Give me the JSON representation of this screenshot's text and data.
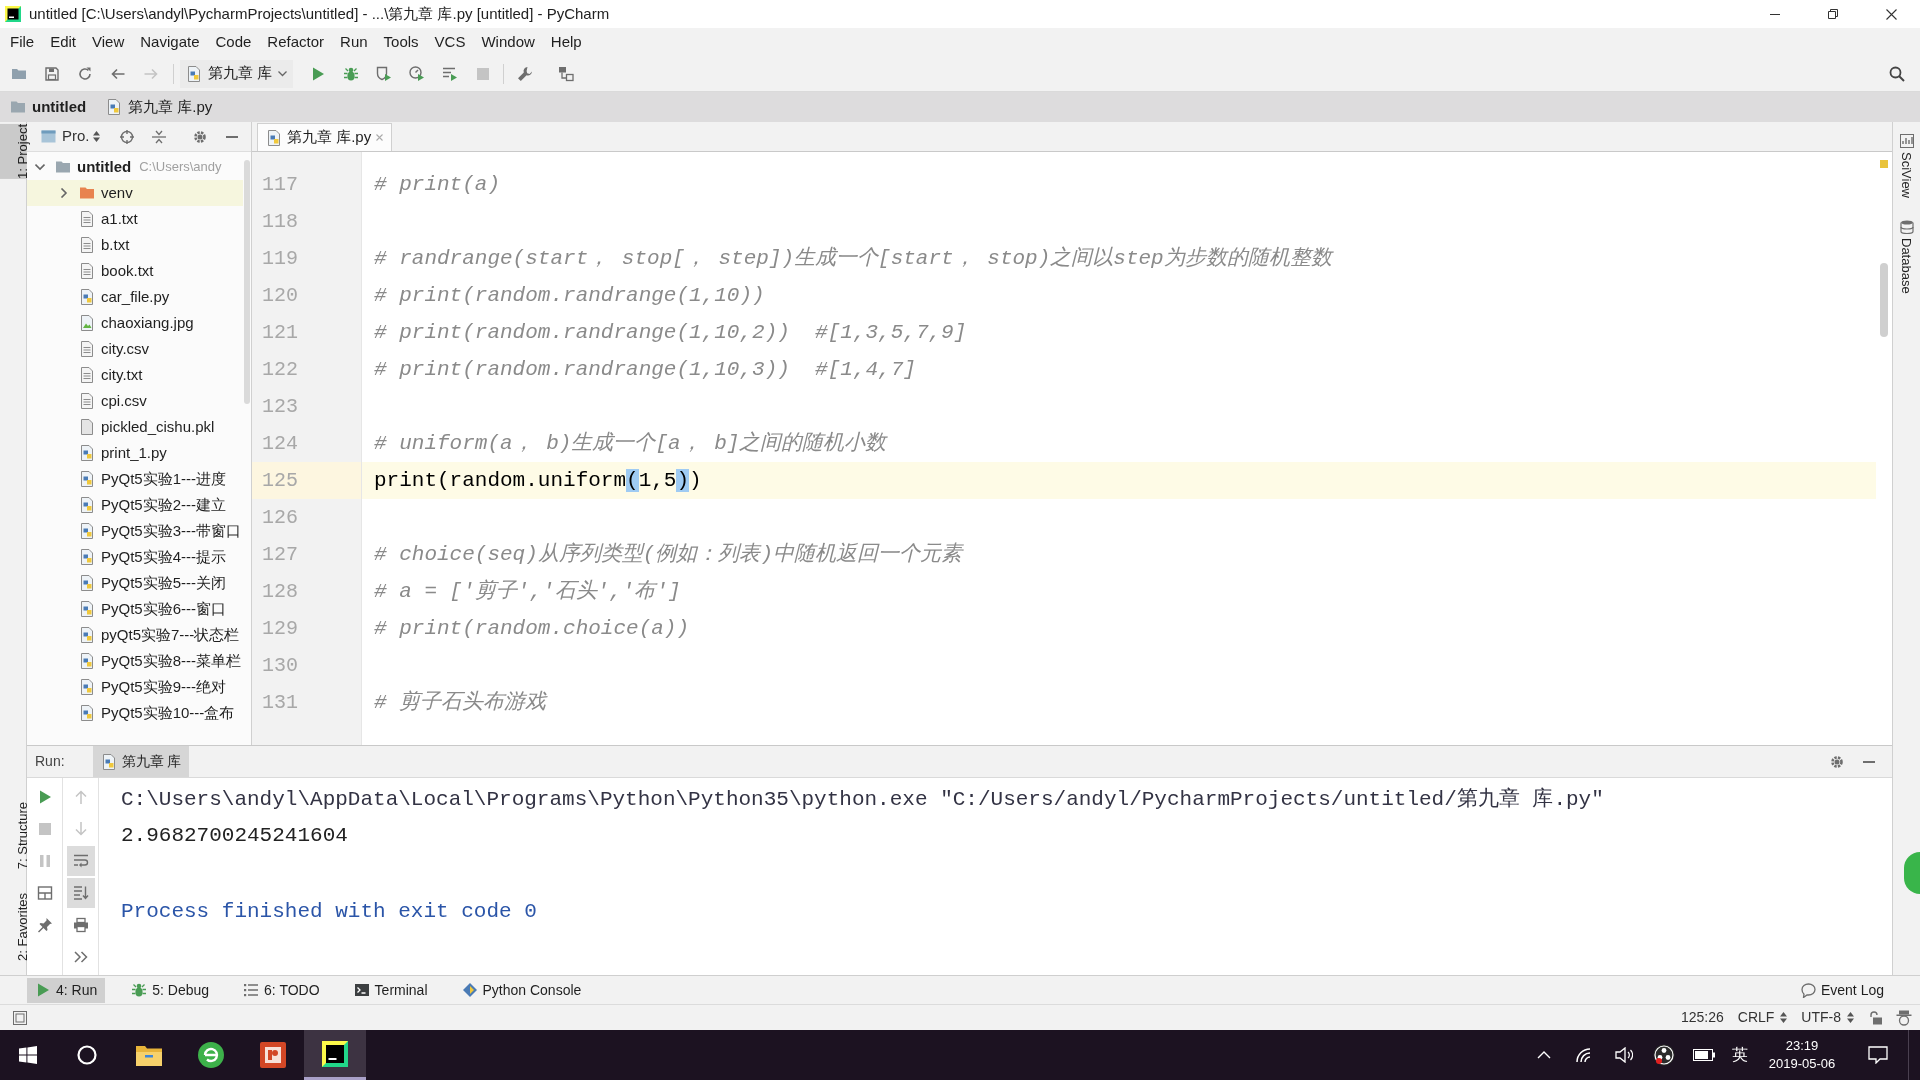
{
  "window": {
    "title": "untitled [C:\\Users\\andyl\\PycharmProjects\\untitled] - ...\\第九章 库.py [untitled] - PyCharm"
  },
  "menu": [
    "File",
    "Edit",
    "View",
    "Navigate",
    "Code",
    "Refactor",
    "Run",
    "Tools",
    "VCS",
    "Window",
    "Help"
  ],
  "toolbar": {
    "buttons": [
      {
        "kind": "open",
        "disabled": false
      },
      {
        "kind": "save",
        "disabled": false
      },
      {
        "kind": "sync",
        "disabled": false
      },
      {
        "kind": "back",
        "disabled": false
      },
      {
        "kind": "forward",
        "disabled": true
      }
    ],
    "run_config": "第九章 库",
    "actions": [
      {
        "kind": "run",
        "disabled": false
      },
      {
        "kind": "debug",
        "disabled": false
      },
      {
        "kind": "coverage",
        "disabled": false
      },
      {
        "kind": "profile",
        "disabled": false
      },
      {
        "kind": "concurrency",
        "disabled": false
      },
      {
        "kind": "stop",
        "disabled": true
      }
    ],
    "tools": [
      {
        "kind": "settings",
        "disabled": false
      },
      {
        "kind": "structure",
        "disabled": false
      }
    ]
  },
  "navigation_bar": [
    {
      "kind": "project",
      "label": "untitled"
    },
    {
      "kind": "python",
      "label": "第九章 库.py"
    }
  ],
  "left_strip": {
    "top": [
      {
        "label": "1: Project",
        "selected": true
      }
    ],
    "bottom": [
      {
        "label": "7: Structure",
        "selected": false
      },
      {
        "label": "2: Favorites",
        "selected": false
      }
    ]
  },
  "right_strip": [
    {
      "kind": "sciview",
      "label": "SciView"
    },
    {
      "kind": "database",
      "label": "Database"
    }
  ],
  "project_panel": {
    "title": "Pro.",
    "tree": [
      {
        "kind": "project",
        "label": "untitled",
        "path": "C:\\Users\\andy",
        "expanded": true,
        "selected": false,
        "children": [
          {
            "kind": "excluded_folder",
            "label": "venv",
            "expanded": false,
            "selected": true
          },
          {
            "kind": "text",
            "label": "a1.txt",
            "selected": false
          },
          {
            "kind": "text",
            "label": "b.txt",
            "selected": false
          },
          {
            "kind": "text",
            "label": "book.txt",
            "selected": false
          },
          {
            "kind": "python",
            "label": "car_file.py",
            "selected": false
          },
          {
            "kind": "image",
            "label": "chaoxiang.jpg",
            "selected": false
          },
          {
            "kind": "text",
            "label": "city.csv",
            "selected": false
          },
          {
            "kind": "text",
            "label": "city.txt",
            "selected": false
          },
          {
            "kind": "text",
            "label": "cpi.csv",
            "selected": false
          },
          {
            "kind": "data",
            "label": "pickled_cishu.pkl",
            "selected": false
          },
          {
            "kind": "python",
            "label": "print_1.py",
            "selected": false
          },
          {
            "kind": "python",
            "label": "PyQt5实验1---进度",
            "selected": false
          },
          {
            "kind": "python",
            "label": "PyQt5实验2---建立",
            "selected": false
          },
          {
            "kind": "python",
            "label": "PyQt5实验3---带窗口",
            "selected": false
          },
          {
            "kind": "python",
            "label": "PyQt5实验4---提示",
            "selected": false
          },
          {
            "kind": "python",
            "label": "PyQt5实验5---关闭",
            "selected": false
          },
          {
            "kind": "python",
            "label": "PyQt5实验6---窗口",
            "selected": false
          },
          {
            "kind": "python",
            "label": "pyQt5实验7---状态栏",
            "selected": false
          },
          {
            "kind": "python",
            "label": "PyQt5实验8---菜单栏",
            "selected": false
          },
          {
            "kind": "python",
            "label": "PyQt5实验9---绝对",
            "selected": false
          },
          {
            "kind": "python",
            "label": "PyQt5实验10---盒布",
            "selected": false
          }
        ]
      }
    ]
  },
  "editor": {
    "tabs": [
      {
        "label": "第九章 库.py",
        "selected": true
      }
    ],
    "lines": [
      {
        "number": "117",
        "kind": "comment",
        "current": false,
        "text": "# print(a)"
      },
      {
        "number": "118",
        "kind": "blank",
        "current": false
      },
      {
        "number": "119",
        "kind": "comment",
        "current": false,
        "text": "# randrange(start， stop[， step])生成一个[start， stop)之间以step为步数的随机整数"
      },
      {
        "number": "120",
        "kind": "comment",
        "current": false,
        "text": "# print(random.randrange(1,10))"
      },
      {
        "number": "121",
        "kind": "comment",
        "current": false,
        "text": "# print(random.randrange(1,10,2))  #[1,3,5,7,9]"
      },
      {
        "number": "122",
        "kind": "comment",
        "current": false,
        "text": "# print(random.randrange(1,10,3))  #[1,4,7]"
      },
      {
        "number": "123",
        "kind": "blank",
        "current": false
      },
      {
        "number": "124",
        "kind": "comment",
        "current": false,
        "text": "# uniform(a， b)生成一个[a， b]之间的随机小数"
      },
      {
        "number": "125",
        "kind": "code",
        "current": true,
        "segments": [
          {
            "text": "print(random.uniform",
            "matched": false
          },
          {
            "text": "(",
            "matched": true
          },
          {
            "text": "1,5",
            "matched": false
          },
          {
            "text": ")",
            "matched": true
          },
          {
            "text": ")",
            "matched": false
          }
        ]
      },
      {
        "number": "126",
        "kind": "blank",
        "current": false
      },
      {
        "number": "127",
        "kind": "comment",
        "current": false,
        "text": "# choice(seq)从序列类型(例如：列表)中随机返回一个元素"
      },
      {
        "number": "128",
        "kind": "comment",
        "current": false,
        "text": "# a = ['剪子','石头','布']"
      },
      {
        "number": "129",
        "kind": "comment",
        "current": false,
        "text": "# print(random.choice(a))"
      },
      {
        "number": "130",
        "kind": "blank",
        "current": false
      },
      {
        "number": "131",
        "kind": "comment",
        "current": false,
        "text": "# 剪子石头布游戏"
      }
    ]
  },
  "run_panel": {
    "label": "Run:",
    "tabs": [
      {
        "label": "第九章 库",
        "selected": true
      }
    ],
    "toolbars": [
      [
        {
          "kind": "rerun",
          "disabled": false,
          "on": false
        },
        {
          "kind": "stop",
          "disabled": true,
          "on": false
        },
        {
          "kind": "pause",
          "disabled": true,
          "on": false
        },
        {
          "kind": "layout",
          "disabled": false,
          "on": false
        },
        {
          "kind": "pin",
          "disabled": false,
          "on": false
        }
      ],
      [
        {
          "kind": "up",
          "disabled": true,
          "on": false
        },
        {
          "kind": "down",
          "disabled": true,
          "on": false
        },
        {
          "kind": "wrap",
          "disabled": false,
          "on": true
        },
        {
          "kind": "scroll",
          "disabled": false,
          "on": true
        },
        {
          "kind": "print",
          "disabled": false,
          "on": false
        },
        {
          "kind": "more",
          "disabled": false,
          "on": false
        }
      ]
    ],
    "output": [
      {
        "kind": "command",
        "text": "C:\\Users\\andyl\\AppData\\Local\\Programs\\Python\\Python35\\python.exe \"C:/Users/andyl/PycharmProjects/untitled/第九章 库.py\""
      },
      {
        "kind": "stdout",
        "text": "2.9682700245241604"
      },
      {
        "kind": "system",
        "text": "Process finished with exit code 0"
      }
    ]
  },
  "bottom_bar": {
    "tabs": [
      {
        "kind": "run",
        "label": "4: Run",
        "selected": true
      },
      {
        "kind": "debug",
        "label": "5: Debug",
        "selected": false
      },
      {
        "kind": "todo",
        "label": "6: TODO",
        "selected": false
      },
      {
        "kind": "terminal",
        "label": "Terminal",
        "selected": false
      },
      {
        "kind": "console",
        "label": "Python Console",
        "selected": false
      }
    ],
    "event_log": "Event Log"
  },
  "status_bar": {
    "items": [
      {
        "kind": "position",
        "label": "125:26"
      },
      {
        "kind": "dropdown",
        "label": "CRLF"
      },
      {
        "kind": "dropdown",
        "label": "UTF-8"
      }
    ]
  },
  "taskbar": {
    "apps": [
      {
        "kind": "start",
        "active": false
      },
      {
        "kind": "search",
        "active": false
      },
      {
        "kind": "explorer",
        "active": false
      },
      {
        "kind": "browser",
        "active": false
      },
      {
        "kind": "presentation",
        "active": false
      },
      {
        "kind": "ide",
        "active": true
      }
    ],
    "ime": "英",
    "time": "23:19",
    "date": "2019-05-06"
  }
}
